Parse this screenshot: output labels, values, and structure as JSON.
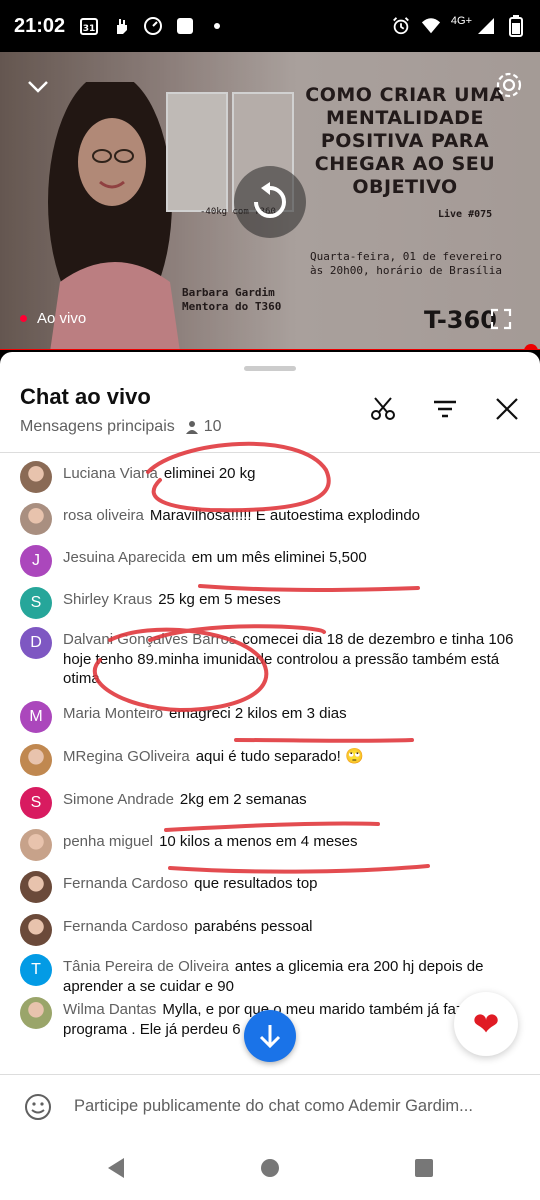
{
  "status_bar": {
    "time": "21:02",
    "calendar_day": "31",
    "network": "4G+"
  },
  "video": {
    "headline": "COMO CRIAR UMA MENTALIDADE POSITIVA PARA CHEGAR AO SEU OBJETIVO",
    "live_number": "Live #075",
    "date_line_1": "Quarta-feira, 01 de fevereiro",
    "date_line_2": "às 20h00, horário de Brasília",
    "presenter_name": "Barbara Gardim",
    "presenter_role": "Mentora do T360",
    "weight_caption": "-40kg com T360",
    "brand": "T-360",
    "live_label": "Ao vivo",
    "accent_color": "#ff0000"
  },
  "chat": {
    "title": "Chat ao vivo",
    "filter_label": "Mensagens principais",
    "viewer_count": "10",
    "input_placeholder": "Participe publicamente do chat como Ademir Gardim...",
    "messages": [
      {
        "author": "Luciana Viana",
        "text": "eliminei 20 kg",
        "avatar": "photo",
        "avatar_color": "#8a6a55"
      },
      {
        "author": "rosa oliveira",
        "text": "Maravilhosa!!!!! E autoestima explodindo",
        "avatar": "photo",
        "avatar_color": "#a98f80"
      },
      {
        "author": "Jesuina Aparecida",
        "text": "em um mês eliminei 5,500",
        "avatar": "J",
        "avatar_color": "#ab47bc"
      },
      {
        "author": "Shirley Kraus",
        "text": "25 kg em 5 meses",
        "avatar": "S",
        "avatar_color": "#26a69a"
      },
      {
        "author": "Dalvani Gonçalves Barros",
        "text": "comecei dia 18 de dezembro e tinha 106 hoje tenho 89.minha imunidade controlou a pressão também está otima",
        "avatar": "D",
        "avatar_color": "#7e57c2"
      },
      {
        "author": "Maria Monteiro",
        "text": "emagreci 2 kilos em 3 dias",
        "avatar": "M",
        "avatar_color": "#ab47bc"
      },
      {
        "author": "MRegina GOliveira",
        "text": "aqui é tudo separado! 🙄",
        "avatar": "photo",
        "avatar_color": "#c08850"
      },
      {
        "author": "Simone Andrade",
        "text": "2kg em 2 semanas",
        "avatar": "S",
        "avatar_color": "#d81b60"
      },
      {
        "author": "penha miguel",
        "text": "10 kilos a menos em 4 meses",
        "avatar": "photo",
        "avatar_color": "#c7a28a"
      },
      {
        "author": "Fernanda Cardoso",
        "text": "que resultados top",
        "avatar": "photo",
        "avatar_color": "#6b4a3a"
      },
      {
        "author": "Fernanda Cardoso",
        "text": "parabéns pessoal",
        "avatar": "photo",
        "avatar_color": "#6b4a3a"
      },
      {
        "author": "Tânia Pereira de Oliveira",
        "text": "antes a glicemia era 200 hj depois de aprender a se cuidar e 90",
        "avatar": "T",
        "avatar_color": "#039be5"
      },
      {
        "author": "Wilma Dantas",
        "text": "Mylla, e por que o meu marido também já faz o programa . Ele já perdeu 6",
        "avatar": "photo",
        "avatar_color": "#9aa56a"
      }
    ]
  },
  "colors": {
    "fab_blue": "#1a73e8",
    "heart_red": "#e01b24",
    "annotation_red": "#e0393e"
  }
}
